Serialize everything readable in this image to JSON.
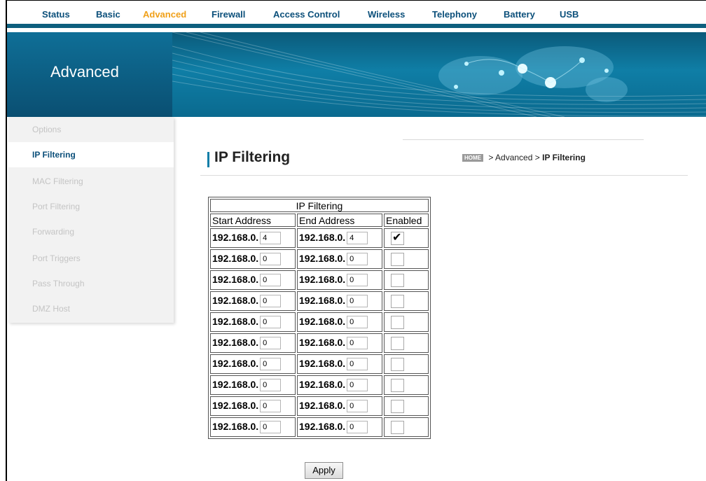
{
  "nav": {
    "tabs": [
      {
        "label": "Status"
      },
      {
        "label": "Basic"
      },
      {
        "label": "Advanced"
      },
      {
        "label": "Firewall"
      },
      {
        "label": "Access Control"
      },
      {
        "label": "Wireless"
      },
      {
        "label": "Telephony"
      },
      {
        "label": "Battery"
      },
      {
        "label": "USB"
      }
    ],
    "active": "Advanced"
  },
  "banner": {
    "title": "Advanced"
  },
  "sidebar": {
    "items": [
      {
        "label": "Options"
      },
      {
        "label": "IP Filtering"
      },
      {
        "label": "MAC Filtering"
      },
      {
        "label": "Port Filtering"
      },
      {
        "label": "Forwarding"
      },
      {
        "label": "Port Triggers"
      },
      {
        "label": "Pass Through"
      },
      {
        "label": "DMZ Host"
      }
    ],
    "active": "IP Filtering"
  },
  "page": {
    "title": "IP Filtering"
  },
  "breadcrumb": {
    "home": "HOME",
    "sep": ">",
    "section": "Advanced",
    "current": "IP Filtering"
  },
  "table": {
    "caption": "IP Filtering",
    "headers": {
      "start": "Start Address",
      "end": "End Address",
      "enabled": "Enabled"
    },
    "prefix": "192.168.0.",
    "rows": [
      {
        "start": "4",
        "end": "4",
        "enabled": true
      },
      {
        "start": "0",
        "end": "0",
        "enabled": false
      },
      {
        "start": "0",
        "end": "0",
        "enabled": false
      },
      {
        "start": "0",
        "end": "0",
        "enabled": false
      },
      {
        "start": "0",
        "end": "0",
        "enabled": false
      },
      {
        "start": "0",
        "end": "0",
        "enabled": false
      },
      {
        "start": "0",
        "end": "0",
        "enabled": false
      },
      {
        "start": "0",
        "end": "0",
        "enabled": false
      },
      {
        "start": "0",
        "end": "0",
        "enabled": false
      },
      {
        "start": "0",
        "end": "0",
        "enabled": false
      }
    ]
  },
  "apply_label": "Apply",
  "colors": {
    "nav_text": "#0b4f7a",
    "nav_active": "#f0a019",
    "banner": "#0f7ea6",
    "accent": "#0e7ea8"
  }
}
